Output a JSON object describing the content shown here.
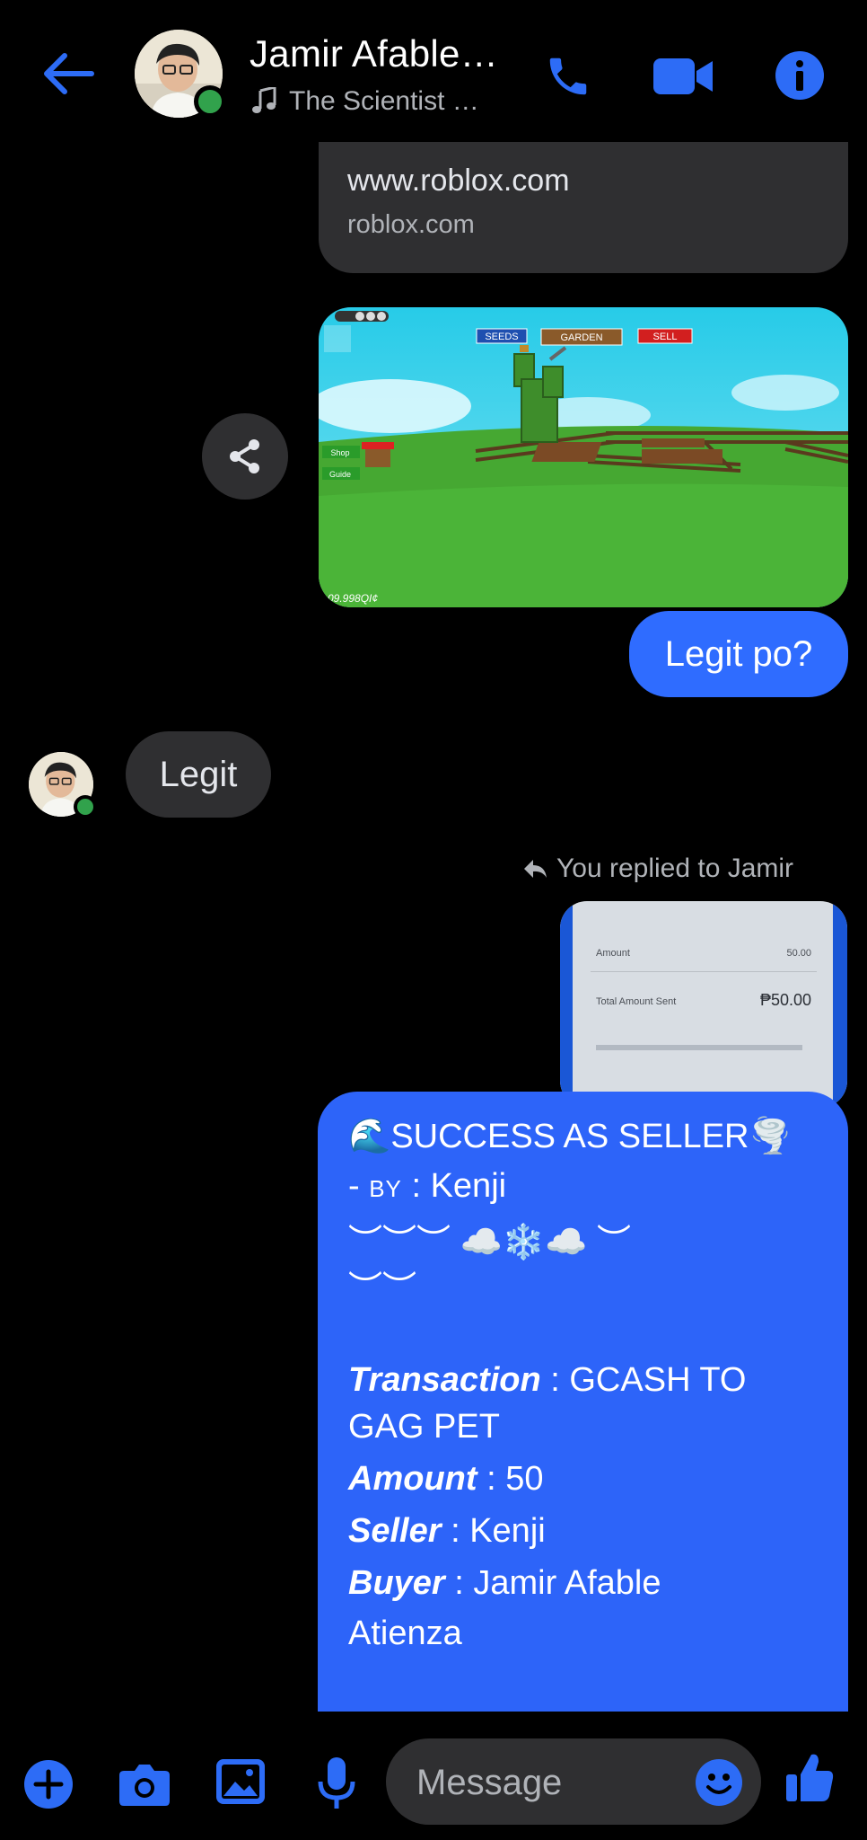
{
  "header": {
    "title": "Jamir Afable…",
    "subtitle": "The Scientist …",
    "accent": "#0a7cff"
  },
  "link_card": {
    "title": "www.roblox.com",
    "domain": "roblox.com"
  },
  "game_screenshot": {
    "tabs": [
      "SEEDS",
      "GARDEN",
      "SELL"
    ],
    "side_buttons": [
      "Shop",
      "Guide"
    ],
    "money": "09.998QI¢"
  },
  "messages": {
    "outgoing_1": "Legit po?",
    "incoming_1": "Legit",
    "reply_note": "You replied to Jamir"
  },
  "reply_preview": {
    "amount_label": "Amount",
    "amount_value": "50.00",
    "total_label": "Total Amount Sent",
    "total_value": "₱50.00"
  },
  "big_message": {
    "line1": "🌊SUCCESS AS SELLER🌪️",
    "line2_prefix": "- ",
    "line2_by": "BY",
    "line2_rest": " : Kenji",
    "line3": "︶︶︶ ☁️❄️☁️ ︶",
    "line4": "︶︶",
    "transaction_label": "Transaction",
    "transaction_value": " : GCASH TO",
    "transaction_value_2": "GAG PET",
    "amount_label": "Amount",
    "amount_value": " : 50",
    "seller_label": "Seller",
    "seller_value": " : Kenji",
    "buyer_label": "Buyer",
    "buyer_value": " : Jamir Afable",
    "buyer_value_2": "Atienza"
  },
  "composer": {
    "placeholder": "Message"
  }
}
